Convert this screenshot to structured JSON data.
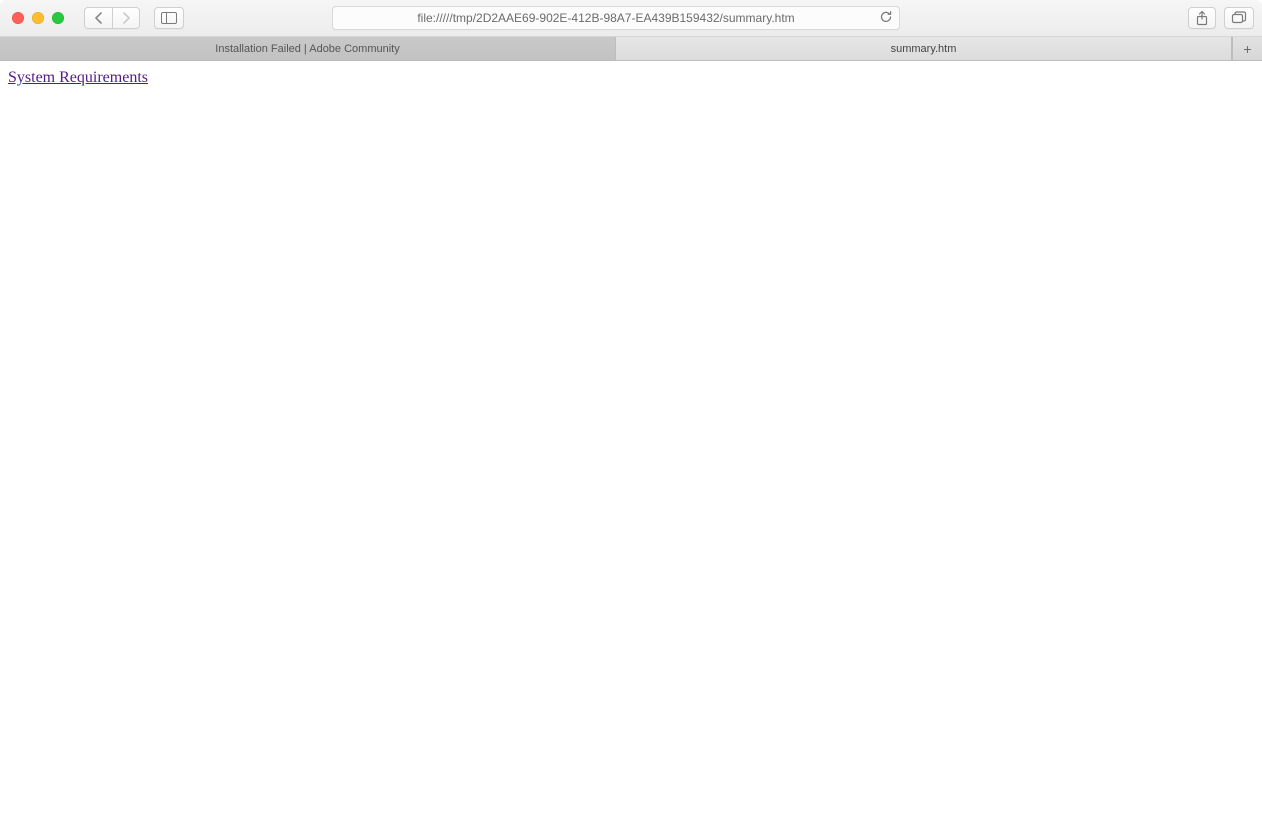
{
  "toolbar": {
    "url": "file://///tmp/2D2AAE69-902E-412B-98A7-EA439B159432/summary.htm"
  },
  "tabs": [
    {
      "label": "Installation Failed | Adobe Community",
      "active": false
    },
    {
      "label": "summary.htm",
      "active": true
    }
  ],
  "page": {
    "link_text": "System Requirements"
  },
  "icons": {
    "back": "chevron-left",
    "forward": "chevron-right",
    "sidebar": "sidebar",
    "reload": "reload",
    "share": "share",
    "tabs": "tabs-overview",
    "new_tab": "+"
  }
}
